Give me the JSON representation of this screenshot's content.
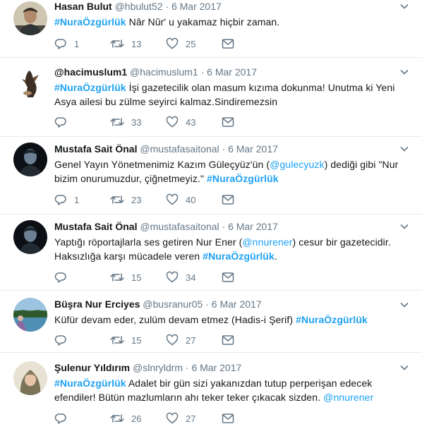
{
  "colors": {
    "link": "#1da1f2",
    "muted": "#657786",
    "divider": "#e6ecf0"
  },
  "tweets": [
    {
      "name": "Hasan Bulut",
      "handle": "@hbulut52",
      "dot": "·",
      "date": "6 Mar 2017",
      "segments": [
        {
          "t": "tag",
          "v": "#NuraÖzgürlük"
        },
        {
          "t": "text",
          "v": " Nâr Nûr' u yakamaz hiçbir zaman."
        }
      ],
      "replies": "1",
      "retweets": "13",
      "likes": "25",
      "avatar": "man-portrait"
    },
    {
      "name": "@hacimuslum1",
      "handle": "@hacimuslum1",
      "dot": "·",
      "date": "6 Mar 2017",
      "segments": [
        {
          "t": "tag",
          "v": "#NuraÖzgürlük"
        },
        {
          "t": "text",
          "v": " İşi gazetecilik olan masum kızıma dokunma! Unutma ki Yeni Asya ailesi bu zülme seyirci kalmaz.Sindiremezsin"
        }
      ],
      "replies": "",
      "retweets": "33",
      "likes": "43",
      "avatar": "bird-silhouette"
    },
    {
      "name": "Mustafa Sait Önal",
      "handle": "@mustafasaitonal",
      "dot": "·",
      "date": "6 Mar 2017",
      "segments": [
        {
          "t": "text",
          "v": "Genel Yayın Yönetmenimiz Kazım Güleçyüz'ün ("
        },
        {
          "t": "mention",
          "v": "@gulecyuzk"
        },
        {
          "t": "text",
          "v": ") dediği gibi \"Nur bizim onurumuzdur, çiğnetmeyiz.\" "
        },
        {
          "t": "tag",
          "v": "#NuraÖzgürlük"
        }
      ],
      "replies": "1",
      "retweets": "23",
      "likes": "40",
      "avatar": "man-dark-portrait"
    },
    {
      "name": "Mustafa Sait Önal",
      "handle": "@mustafasaitonal",
      "dot": "·",
      "date": "6 Mar 2017",
      "segments": [
        {
          "t": "text",
          "v": "Yaptığı röportajlarla ses getiren Nur Ener ("
        },
        {
          "t": "mention",
          "v": "@nnurener"
        },
        {
          "t": "text",
          "v": ") cesur bir gazetecidir. Haksızlığa karşı mücadele veren "
        },
        {
          "t": "tag",
          "v": "#NuraÖzgürlük"
        },
        {
          "t": "text",
          "v": "."
        }
      ],
      "replies": "",
      "retweets": "15",
      "likes": "34",
      "avatar": "man-dark-portrait"
    },
    {
      "name": "Büşra Nur Erciyes",
      "handle": "@busranur05",
      "dot": "·",
      "date": "6 Mar 2017",
      "segments": [
        {
          "t": "text",
          "v": "Küfür devam eder, zulüm devam etmez (Hadis-i Şerif) "
        },
        {
          "t": "tag",
          "v": "#NuraÖzgürlük"
        }
      ],
      "replies": "",
      "retweets": "15",
      "likes": "27",
      "avatar": "lake-landscape"
    },
    {
      "name": "Şulenur Yıldırım",
      "handle": "@slnryldrm",
      "dot": "·",
      "date": "6 Mar 2017",
      "segments": [
        {
          "t": "tag",
          "v": "#NuraÖzgürlük"
        },
        {
          "t": "text",
          "v": " Adalet bir gün sizi yakanızdan tutup perperişan edecek efendiler! Bütün mazlumların ahı teker teker çıkacak sizden. "
        },
        {
          "t": "mention",
          "v": "@nnurener"
        }
      ],
      "replies": "",
      "retweets": "26",
      "likes": "27",
      "avatar": "woman-headscarf"
    }
  ]
}
